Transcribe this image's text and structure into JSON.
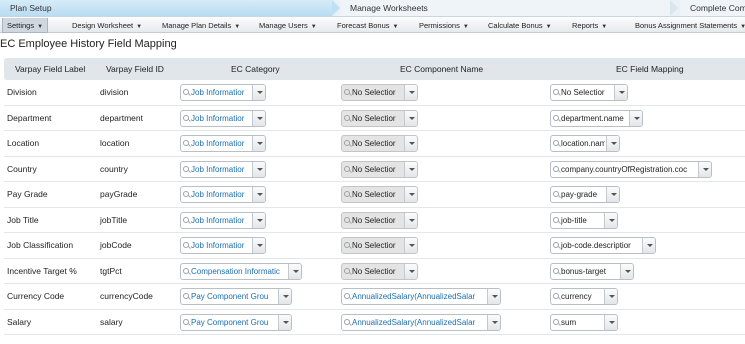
{
  "wizard": {
    "steps": [
      "Plan Setup",
      "Manage Worksheets",
      "Complete Comp"
    ]
  },
  "menubar": {
    "items": [
      {
        "label": "Settings",
        "active": true
      },
      {
        "label": "Design Worksheet",
        "active": false
      },
      {
        "label": "Manage Plan Details",
        "active": false
      },
      {
        "label": "Manage Users",
        "active": false
      },
      {
        "label": "Forecast Bonus",
        "active": false
      },
      {
        "label": "Permissions",
        "active": false
      },
      {
        "label": "Calculate Bonus",
        "active": false
      },
      {
        "label": "Reports",
        "active": false
      },
      {
        "label": "Bonus Assignment Statements",
        "active": false
      }
    ]
  },
  "page_title": "EC Employee History Field Mapping",
  "table": {
    "headers": [
      "Varpay Field Label",
      "Varpay Field ID",
      "EC Category",
      "EC Component Name",
      "EC Field Mapping"
    ],
    "rows": [
      {
        "label": "Division",
        "id": "division",
        "category": "Job Informatior",
        "component": "No Selectior",
        "component_disabled": true,
        "mapping": "No Selectior"
      },
      {
        "label": "Department",
        "id": "department",
        "category": "Job Informatior",
        "component": "No Selectior",
        "component_disabled": true,
        "mapping": "department.name"
      },
      {
        "label": "Location",
        "id": "location",
        "category": "Job Informatior",
        "component": "No Selectior",
        "component_disabled": true,
        "mapping": "location.name"
      },
      {
        "label": "Country",
        "id": "country",
        "category": "Job Informatior",
        "component": "No Selectior",
        "component_disabled": true,
        "mapping": "company.countryOfRegistration.coc"
      },
      {
        "label": "Pay Grade",
        "id": "payGrade",
        "category": "Job Informatior",
        "component": "No Selectior",
        "component_disabled": true,
        "mapping": "pay-grade"
      },
      {
        "label": "Job Title",
        "id": "jobTitle",
        "category": "Job Informatior",
        "component": "No Selectior",
        "component_disabled": true,
        "mapping": "job-title"
      },
      {
        "label": "Job Classification",
        "id": "jobCode",
        "category": "Job Informatior",
        "component": "No Selectior",
        "component_disabled": true,
        "mapping": "job-code.descriptior"
      },
      {
        "label": "Incentive Target %",
        "id": "tgtPct",
        "category": "Compensation Informatic",
        "component": "No Selectior",
        "component_disabled": true,
        "mapping": "bonus-target"
      },
      {
        "label": "Currency Code",
        "id": "currencyCode",
        "category": "Pay Component Grou",
        "component": "AnnualizedSalary(AnnualizedSalar",
        "component_disabled": false,
        "mapping": "currency"
      },
      {
        "label": "Salary",
        "id": "salary",
        "category": "Pay Component Grou",
        "component": "AnnualizedSalary(AnnualizedSalar",
        "component_disabled": false,
        "mapping": "sum"
      }
    ]
  }
}
